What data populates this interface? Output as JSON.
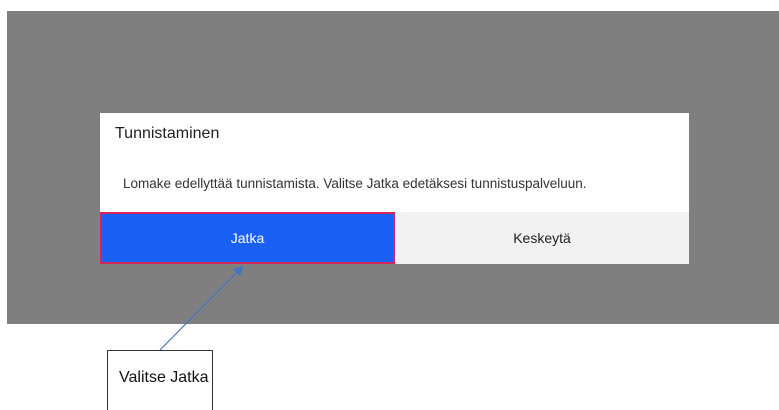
{
  "dialog": {
    "title": "Tunnistaminen",
    "message": "Lomake edellyttää tunnistamista. Valitse Jatka edetäksesi tunnistuspalveluun.",
    "continue_label": "Jatka",
    "cancel_label": "Keskeytä"
  },
  "annotation": {
    "text": "Valitse Jatka"
  },
  "colors": {
    "overlay": "#7f7f7f",
    "primary_button": "#1a60f5",
    "highlight_border": "#d6245c",
    "secondary_button": "#f2f2f2",
    "arrow": "#4472c4"
  }
}
